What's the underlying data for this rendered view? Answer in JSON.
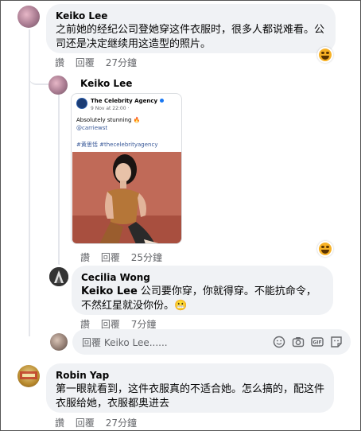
{
  "comments": [
    {
      "name": "Keiko Lee",
      "text": "之前她的经纪公司登她穿这件衣服时，很多人都说难看。公司还是决定继续用这造型的照片。",
      "actions": [
        "讚",
        "回覆",
        "27分鐘"
      ]
    },
    {
      "name": "Keiko Lee",
      "actions": [
        "讚",
        "回覆",
        "25分鐘"
      ],
      "shared_post": {
        "page_name": "The Celebrity Agency",
        "date": "9 Nov at 22:00 ·",
        "line1": "Absolutely stunning 🔥",
        "mention": "@carriewst",
        "hashtags": "#黄思恬 #thecelebrityagency"
      }
    },
    {
      "name": "Cecilia Wong",
      "mention": "Keiko Lee",
      "text": " 公司要你穿，你就得穿。不能抗命令，不然红星就没你份。😬",
      "actions": [
        "讚",
        "回覆",
        "7分鐘"
      ]
    },
    {
      "name": "Robin Yap",
      "text": "第一眼就看到，这件衣服真的不适合她。怎么搞的，配这件衣服给她，衣服都奥进去",
      "actions": [
        "讚",
        "回覆",
        "27分鐘"
      ]
    }
  ],
  "reply_box": {
    "value": "回覆 Keiko Lee......"
  },
  "icons": {
    "reaction": "laughing-face-icon",
    "tools": [
      "emoji-icon",
      "camera-icon",
      "gif-icon",
      "sticker-icon"
    ]
  },
  "colors": {
    "bubble": "#f0f2f5",
    "meta": "#65676b",
    "link": "#385898",
    "reaction": "#f7b125"
  }
}
